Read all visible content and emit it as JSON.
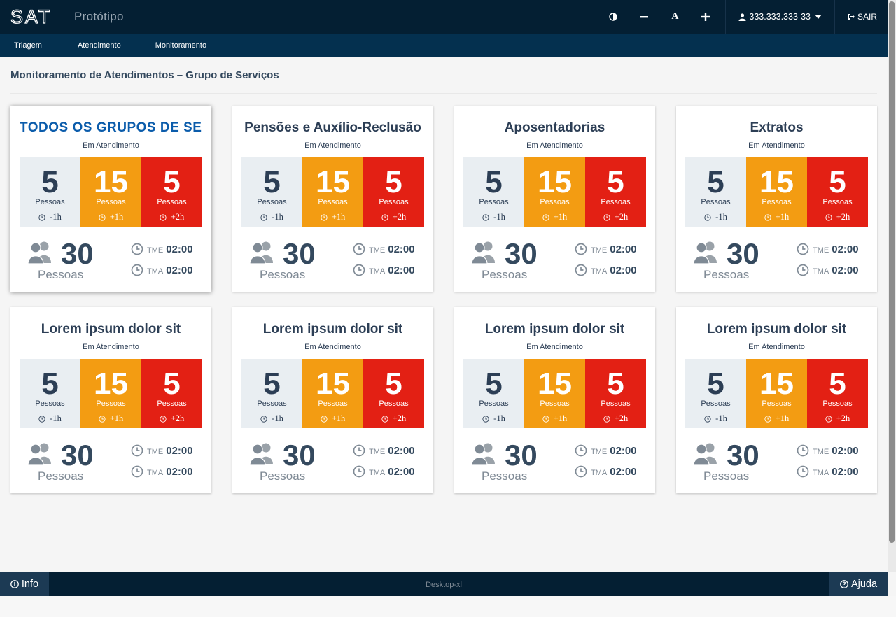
{
  "header": {
    "logo_text": "SAT",
    "app_title": "Protótipo",
    "contrast_icon": "contrast-icon",
    "decrease_font_icon": "minus-icon",
    "font_label": "A",
    "increase_font_icon": "plus-icon",
    "user_id": "333.333.333-33",
    "logout_label": "SAIR"
  },
  "nav": {
    "items": [
      "Triagem",
      "Atendimento",
      "Monitoramento"
    ]
  },
  "page": {
    "title": "Monitoramento de Atendimentos – Grupo de Serviços"
  },
  "colors": {
    "topbar": "#041f33",
    "navbar": "#04304f",
    "gray": "#e9eef2",
    "orange": "#f39c12",
    "red": "#e32014",
    "selected_title": "#0b5cab"
  },
  "cards": [
    {
      "title": "TODOS OS GRUPOS DE SE...",
      "status": "Em Atendimento",
      "stats": [
        {
          "value": "5",
          "label": "Pessoas",
          "time": "-1h"
        },
        {
          "value": "15",
          "label": "Pessoas",
          "time": "+1h"
        },
        {
          "value": "5",
          "label": "Pessoas",
          "time": "+2h"
        }
      ],
      "total": "30",
      "total_label": "Pessoas",
      "tme_label": "TME",
      "tme": "02:00",
      "tma_label": "TMA",
      "tma": "02:00"
    },
    {
      "title": "Pensões e Auxílio-Reclusão",
      "status": "Em Atendimento",
      "stats": [
        {
          "value": "5",
          "label": "Pessoas",
          "time": "-1h"
        },
        {
          "value": "15",
          "label": "Pessoas",
          "time": "+1h"
        },
        {
          "value": "5",
          "label": "Pessoas",
          "time": "+2h"
        }
      ],
      "total": "30",
      "total_label": "Pessoas",
      "tme_label": "TME",
      "tme": "02:00",
      "tma_label": "TMA",
      "tma": "02:00"
    },
    {
      "title": "Aposentadorias",
      "status": "Em Atendimento",
      "stats": [
        {
          "value": "5",
          "label": "Pessoas",
          "time": "-1h"
        },
        {
          "value": "15",
          "label": "Pessoas",
          "time": "+1h"
        },
        {
          "value": "5",
          "label": "Pessoas",
          "time": "+2h"
        }
      ],
      "total": "30",
      "total_label": "Pessoas",
      "tme_label": "TME",
      "tme": "02:00",
      "tma_label": "TMA",
      "tma": "02:00"
    },
    {
      "title": "Extratos",
      "status": "Em Atendimento",
      "stats": [
        {
          "value": "5",
          "label": "Pessoas",
          "time": "-1h"
        },
        {
          "value": "15",
          "label": "Pessoas",
          "time": "+1h"
        },
        {
          "value": "5",
          "label": "Pessoas",
          "time": "+2h"
        }
      ],
      "total": "30",
      "total_label": "Pessoas",
      "tme_label": "TME",
      "tme": "02:00",
      "tma_label": "TMA",
      "tma": "02:00"
    },
    {
      "title": "Lorem ipsum dolor sit",
      "status": "Em Atendimento",
      "stats": [
        {
          "value": "5",
          "label": "Pessoas",
          "time": "-1h"
        },
        {
          "value": "15",
          "label": "Pessoas",
          "time": "+1h"
        },
        {
          "value": "5",
          "label": "Pessoas",
          "time": "+2h"
        }
      ],
      "total": "30",
      "total_label": "Pessoas",
      "tme_label": "TME",
      "tme": "02:00",
      "tma_label": "TMA",
      "tma": "02:00"
    },
    {
      "title": "Lorem ipsum dolor sit",
      "status": "Em Atendimento",
      "stats": [
        {
          "value": "5",
          "label": "Pessoas",
          "time": "-1h"
        },
        {
          "value": "15",
          "label": "Pessoas",
          "time": "+1h"
        },
        {
          "value": "5",
          "label": "Pessoas",
          "time": "+2h"
        }
      ],
      "total": "30",
      "total_label": "Pessoas",
      "tme_label": "TME",
      "tme": "02:00",
      "tma_label": "TMA",
      "tma": "02:00"
    },
    {
      "title": "Lorem ipsum dolor sit",
      "status": "Em Atendimento",
      "stats": [
        {
          "value": "5",
          "label": "Pessoas",
          "time": "-1h"
        },
        {
          "value": "15",
          "label": "Pessoas",
          "time": "+1h"
        },
        {
          "value": "5",
          "label": "Pessoas",
          "time": "+2h"
        }
      ],
      "total": "30",
      "total_label": "Pessoas",
      "tme_label": "TME",
      "tme": "02:00",
      "tma_label": "TMA",
      "tma": "02:00"
    },
    {
      "title": "Lorem ipsum dolor sit",
      "status": "Em Atendimento",
      "stats": [
        {
          "value": "5",
          "label": "Pessoas",
          "time": "-1h"
        },
        {
          "value": "15",
          "label": "Pessoas",
          "time": "+1h"
        },
        {
          "value": "5",
          "label": "Pessoas",
          "time": "+2h"
        }
      ],
      "total": "30",
      "total_label": "Pessoas",
      "tme_label": "TME",
      "tme": "02:00",
      "tma_label": "TMA",
      "tma": "02:00"
    }
  ],
  "footer": {
    "info_label": "Info",
    "env_label": "Desktop-xl",
    "help_label": "Ajuda"
  }
}
